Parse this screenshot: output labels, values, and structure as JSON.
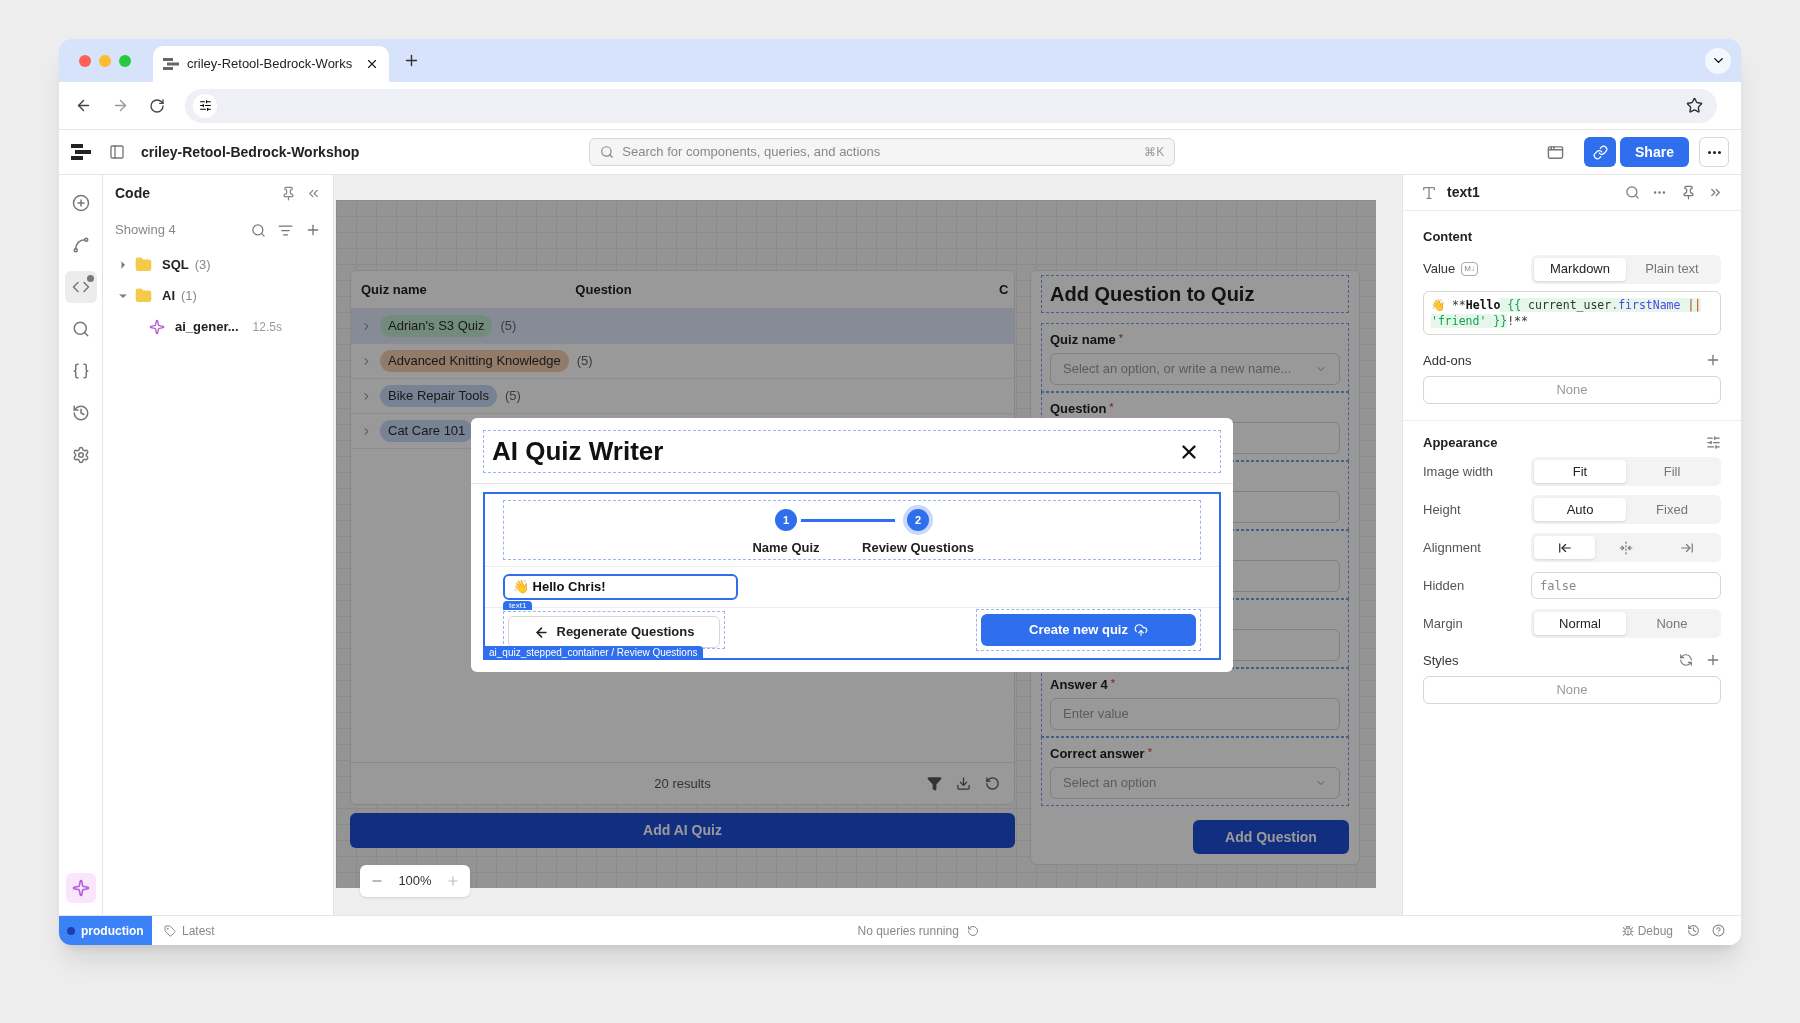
{
  "browser": {
    "tab_title": "criley-Retool-Bedrock-Works"
  },
  "header": {
    "title": "criley-Retool-Bedrock-Workshop",
    "search_placeholder": "Search for components, queries, and actions",
    "shortcut": "⌘K",
    "share": "Share"
  },
  "rail": [
    {
      "kind": "add",
      "selected": false
    },
    {
      "kind": "select",
      "selected": false
    },
    {
      "kind": "code",
      "selected": true
    },
    {
      "kind": "search",
      "selected": false
    },
    {
      "kind": "state",
      "selected": false
    },
    {
      "kind": "history",
      "selected": false
    },
    {
      "kind": "settings",
      "selected": false
    }
  ],
  "code_panel": {
    "title": "Code",
    "showing": "Showing 4",
    "tree": [
      {
        "label": "SQL",
        "count": "(3)",
        "expanded": false
      },
      {
        "label": "AI",
        "count": "(1)",
        "expanded": true,
        "children": [
          {
            "label": "ai_gener...",
            "time": "12.5s"
          }
        ]
      }
    ]
  },
  "table": {
    "columns": [
      "Quiz name",
      "Question",
      "C"
    ],
    "rows": [
      {
        "name": "Adrian's S3 Quiz",
        "count": "(5)",
        "color": "#738b7a",
        "selected": true
      },
      {
        "name": "Advanced Knitting Knowledge",
        "count": "(5)",
        "color": "#937b6a",
        "selected": false
      },
      {
        "name": "Bike Repair Tools",
        "count": "(5)",
        "color": "#778394",
        "selected": false
      },
      {
        "name": "Cat Care 101",
        "color": "#778394",
        "selected": false
      }
    ],
    "footer": "20 results"
  },
  "add_ai_quiz": "Add AI Quiz",
  "form": {
    "title": "Add Question to Quiz",
    "fields": [
      {
        "kind": "select",
        "label": "Quiz name",
        "required_mark": "*",
        "placeholder": "Select an option, or write a new name..."
      },
      {
        "kind": "input",
        "label": "Question",
        "required_mark": "*"
      },
      {
        "kind": "input"
      },
      {
        "kind": "input"
      },
      {
        "kind": "input"
      },
      {
        "kind": "input",
        "label": "Answer 4",
        "required_mark": "*",
        "placeholder": "Enter value"
      },
      {
        "kind": "select",
        "label": "Correct answer",
        "required_mark": "*",
        "placeholder": "Select an option"
      }
    ],
    "button": "Add Question"
  },
  "modal": {
    "title": "AI Quiz Writer",
    "steps": [
      {
        "number": "1",
        "label": "Name Quiz",
        "selected": false
      },
      {
        "number": "2",
        "label": "Review Questions",
        "selected": true
      }
    ],
    "greeting": "👋 Hello Chris!",
    "selection_tag": "text1",
    "back_button": "Regenerate Questions",
    "create_button": "Create new quiz",
    "container_tag": "ai_quiz_stepped_container / Review Questions"
  },
  "zoom": "100%",
  "inspector": {
    "component": "text1",
    "content_title": "Content",
    "value_label": "Value",
    "value_badge": "M↓",
    "value_modes": [
      {
        "label": "Markdown",
        "selected": true
      },
      {
        "label": "Plain text",
        "selected": false
      }
    ],
    "value_tokens": [
      {
        "text": "👋 **",
        "kind": "plain"
      },
      {
        "text": "Hello",
        "kind": "bold"
      },
      {
        "text": " {{",
        "kind": "brace"
      },
      {
        "text": " current_user",
        "kind": "ident"
      },
      {
        "text": ".",
        "kind": "dot"
      },
      {
        "text": "firstName",
        "kind": "prop"
      },
      {
        "text": " ||",
        "kind": "op"
      },
      {
        "text": " 'friend'",
        "kind": "string"
      },
      {
        "text": " }}",
        "kind": "brace"
      },
      {
        "text": "!**",
        "kind": "plain"
      }
    ],
    "addons_label": "Add-ons",
    "addons_value": "None",
    "appearance_title": "Appearance",
    "rows": [
      {
        "kind": "segmented",
        "label": "Image width",
        "options": [
          {
            "label": "Fit",
            "selected": true
          },
          {
            "label": "Fill",
            "selected": false
          }
        ]
      },
      {
        "kind": "segmented",
        "label": "Height",
        "options": [
          {
            "label": "Auto",
            "selected": true
          },
          {
            "label": "Fixed",
            "selected": false
          }
        ]
      },
      {
        "kind": "align",
        "label": "Alignment",
        "options": [
          {
            "kind": "left",
            "selected": true
          },
          {
            "kind": "center",
            "selected": false
          },
          {
            "kind": "right",
            "selected": false
          }
        ]
      },
      {
        "kind": "text",
        "label": "Hidden",
        "value": "false"
      },
      {
        "kind": "segmented",
        "label": "Margin",
        "options": [
          {
            "label": "Normal",
            "selected": true
          },
          {
            "label": "None",
            "selected": false
          }
        ]
      }
    ],
    "styles_label": "Styles",
    "styles_value": "None"
  },
  "status_bar": {
    "environment": "production",
    "version": "Latest",
    "queries": "No queries running",
    "debug": "Debug"
  }
}
